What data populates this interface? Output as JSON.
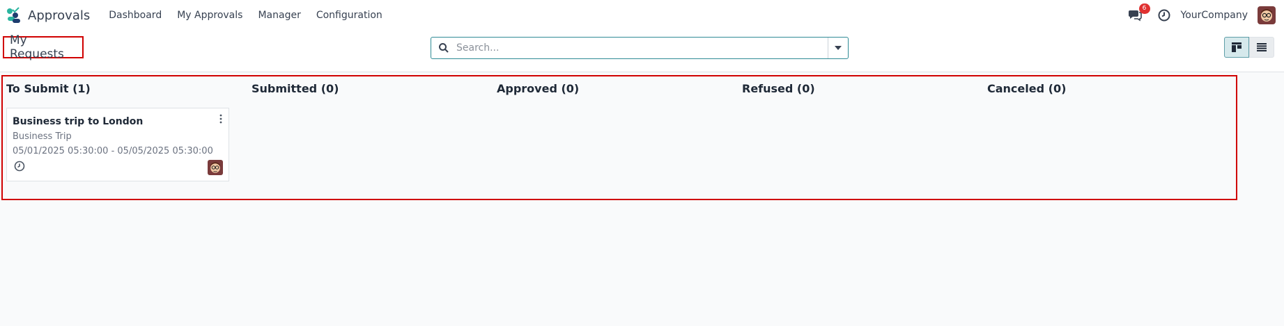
{
  "navbar": {
    "app_name": "Approvals",
    "menu": [
      "Dashboard",
      "My Approvals",
      "Manager",
      "Configuration"
    ],
    "message_count": "6",
    "company": "YourCompany",
    "icons": [
      "approvals-app-icon",
      "chat-icon",
      "clock-icon",
      "user-avatar"
    ]
  },
  "control": {
    "breadcrumb": "My Requests",
    "search_placeholder": "Search...",
    "views": [
      "kanban-view-icon",
      "list-view-icon"
    ]
  },
  "columns": [
    {
      "title": "To Submit (1)"
    },
    {
      "title": "Submitted (0)"
    },
    {
      "title": "Approved (0)"
    },
    {
      "title": "Refused (0)"
    },
    {
      "title": "Canceled (0)"
    }
  ],
  "cards": [
    {
      "title": "Business trip to London",
      "category": "Business Trip",
      "dates": "05/01/2025 05:30:00 - 05/05/2025 05:30:00"
    }
  ],
  "colors": {
    "accent": "#2f8b95",
    "highlight": "#d00000",
    "badge": "#e03131"
  }
}
